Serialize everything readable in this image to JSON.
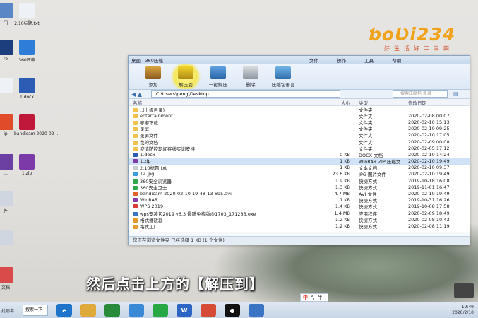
{
  "desktop_icons": [
    {
      "label": "门",
      "color": "#5a86c5"
    },
    {
      "label": "2.10标题.txt",
      "color": "#eef1f6"
    },
    {
      "label": "ro",
      "color": "#1c3e7c"
    },
    {
      "label": "360压缩",
      "color": "#2e7dd6"
    },
    {
      "label": "...",
      "color": "#eef1f6"
    },
    {
      "label": "1.docx",
      "color": "#2b5db5"
    },
    {
      "label": "ip",
      "color": "#e04c2a"
    },
    {
      "label": "bandicam 2020-02-...",
      "color": "#c0183a"
    },
    {
      "label": "...",
      "color": "#6c3fa3"
    },
    {
      "label": "1.zip",
      "color": "#7c3aa8"
    },
    {
      "label": "件",
      "color": "#cfd6df"
    },
    {
      "label": "",
      "color": "#cfd6df"
    },
    {
      "label": "文档",
      "color": "#d94a4a"
    }
  ],
  "logo": {
    "mark": "ƅoƲi234",
    "subtitle": "好生活好二三四"
  },
  "window": {
    "title": "桌面 - 360压缩",
    "menu": [
      "文件",
      "操作",
      "工具",
      "帮助"
    ],
    "toolbar": [
      "添加",
      "解压到",
      "一键解压",
      "删除",
      "压缩包语言"
    ],
    "address": {
      "path": "C:\\Users\\peng\\Desktop",
      "search_placeholder": "搜索压缩包 目录"
    },
    "columns": {
      "name": "名称",
      "size": "大小",
      "type": "类型",
      "date": "修改日期"
    },
    "files": [
      {
        "name": "..(上级目录)",
        "size": "",
        "type": "文件夹",
        "date": "",
        "icon": "folder"
      },
      {
        "name": "entertainment",
        "size": "",
        "type": "文件夹",
        "date": "2020-02-08 00:07",
        "icon": "folder"
      },
      {
        "name": "嘟嘟下载",
        "size": "",
        "type": "文件夹",
        "date": "2020-02-10 15:13",
        "icon": "folder"
      },
      {
        "name": "录屏",
        "size": "",
        "type": "文件夹",
        "date": "2020-02-10 09:25",
        "icon": "folder"
      },
      {
        "name": "录屏文件",
        "size": "",
        "type": "文件夹",
        "date": "2020-02-10 17:05",
        "icon": "folder"
      },
      {
        "name": "我的文档",
        "size": "",
        "type": "文件夹",
        "date": "2020-02-09 00:08",
        "icon": "folder"
      },
      {
        "name": "疫情防控期间在线实训安排",
        "size": "",
        "type": "文件夹",
        "date": "2020-02-05 17:12",
        "icon": "folder"
      },
      {
        "name": "1.docx",
        "size": "0 KB",
        "type": "DOCX 文档",
        "date": "2020-02-10 14:24",
        "icon": "doc"
      },
      {
        "name": "1.zip",
        "size": "1 KB",
        "type": "WinRAR ZIP 压缩文...",
        "date": "2020-02-10 19:49",
        "icon": "zip",
        "selected": true
      },
      {
        "name": "2.10标题.txt",
        "size": "1 KB",
        "type": "文本文档",
        "date": "2020-02-10 09:37",
        "icon": "txt"
      },
      {
        "name": "12.jpg",
        "size": "23.6 KB",
        "type": "JPG 图片文件",
        "date": "2020-02-10 19:49",
        "icon": "img"
      },
      {
        "name": "360安全浏览器",
        "size": "1.9 KB",
        "type": "快捷方式",
        "date": "2019-10-18 16:08",
        "icon": "green"
      },
      {
        "name": "360安全卫士",
        "size": "1.3 KB",
        "type": "快捷方式",
        "date": "2019-11-01 16:47",
        "icon": "green"
      },
      {
        "name": "bandicam 2020-02-10 19-48-13-695.avi",
        "size": "4.7 MB",
        "type": "AVI 文件",
        "date": "2020-02-10 19:49",
        "icon": "avi"
      },
      {
        "name": "WinRAR",
        "size": "1 KB",
        "type": "快捷方式",
        "date": "2019-10-31 16:26",
        "icon": "rar"
      },
      {
        "name": "WPS 2019",
        "size": "1.4 KB",
        "type": "快捷方式",
        "date": "2019-10-08 17:58",
        "icon": "wps"
      },
      {
        "name": "wps安装包2019 v6.3 最新免费版@1703_171283.exe",
        "size": "1.4 MB",
        "type": "应用程序",
        "date": "2020-02-09 18:49",
        "icon": "exe"
      },
      {
        "name": "格式播放器",
        "size": "1.2 KB",
        "type": "快捷方式",
        "date": "2020-02-08 10:43",
        "icon": "app"
      },
      {
        "name": "格式工厂",
        "size": "1.2 KB",
        "type": "快捷方式",
        "date": "2020-02-08 11:19",
        "icon": "app"
      }
    ],
    "status": "您正在浏览文件夹 已经选择 1 KB (1 个文件)"
  },
  "subtitle": "然后点击上方的【解压到】",
  "taskbar": {
    "start_label": "找病毒",
    "search_label": "搜索一下",
    "apps": [
      {
        "name": "ie",
        "color": "#1e74c8",
        "glyph": "e"
      },
      {
        "name": "folder",
        "color": "#e0a93b",
        "glyph": ""
      },
      {
        "name": "store",
        "color": "#2a8a3c",
        "glyph": ""
      },
      {
        "name": "people",
        "color": "#3a89d6",
        "glyph": ""
      },
      {
        "name": "360",
        "color": "#27a844",
        "glyph": ""
      },
      {
        "name": "wps",
        "color": "#2c65c4",
        "glyph": "W"
      },
      {
        "name": "chrome",
        "color": "#d64b35",
        "glyph": ""
      },
      {
        "name": "record",
        "color": "#111111",
        "glyph": "●"
      },
      {
        "name": "archive",
        "color": "#3b74c2",
        "glyph": ""
      }
    ],
    "ime": {
      "lang": "中",
      "punct": "°,",
      "mode": "半"
    },
    "clock": {
      "time": "19:49",
      "date": "2020/2/10"
    }
  }
}
